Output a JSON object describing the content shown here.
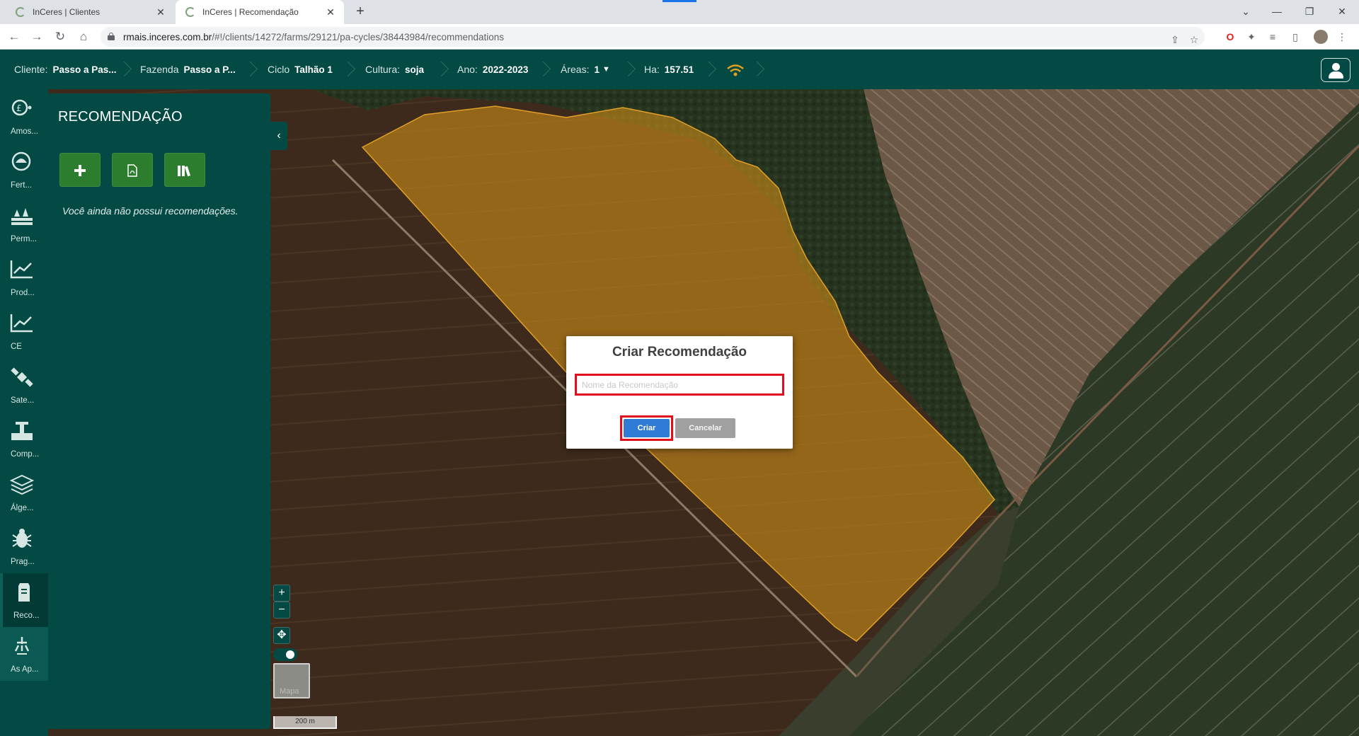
{
  "browser": {
    "tabs": [
      {
        "title": "InCeres | Clientes",
        "active": false
      },
      {
        "title": "InCeres | Recomendação",
        "active": true
      }
    ],
    "url_domain": "rmais.inceres.com.br",
    "url_path": "/#!/clients/14272/farms/29121/pa-cycles/38443984/recommendations"
  },
  "header": {
    "cliente_label": "Cliente:",
    "cliente_value": "Passo a Pas...",
    "fazenda_label": "Fazenda",
    "fazenda_value": "Passo a P...",
    "ciclo_label": "Ciclo",
    "ciclo_value": "Talhão 1",
    "cultura_label": "Cultura:",
    "cultura_value": "soja",
    "ano_label": "Ano:",
    "ano_value": "2022-2023",
    "areas_label": "Áreas:",
    "areas_value": "1",
    "ha_label": "Ha:",
    "ha_value": "157.51"
  },
  "rail": {
    "items": [
      {
        "label": "Amos...",
        "icon": "sampling-icon"
      },
      {
        "label": "Fert...",
        "icon": "fertility-icon"
      },
      {
        "label": "Perm...",
        "icon": "permanent-icon"
      },
      {
        "label": "Prod...",
        "icon": "productivity-chart-icon"
      },
      {
        "label": "CE",
        "icon": "ce-chart-icon"
      },
      {
        "label": "Sate...",
        "icon": "satellite-icon"
      },
      {
        "label": "Comp...",
        "icon": "compaction-icon"
      },
      {
        "label": "Álge...",
        "icon": "layers-icon"
      },
      {
        "label": "Prag...",
        "icon": "bug-icon"
      },
      {
        "label": "Reco...",
        "icon": "recommendation-icon"
      },
      {
        "label": "As Ap...",
        "icon": "sprayer-icon"
      }
    ]
  },
  "panel": {
    "title": "RECOMENDAÇÃO",
    "empty_text": "Você ainda não possui recomendações."
  },
  "map": {
    "scale_label": "200 m",
    "layer_label": "Mapa"
  },
  "modal": {
    "title": "Criar Recomendação",
    "input_placeholder": "Nome da Recomendação",
    "input_value": "",
    "create_label": "Criar",
    "cancel_label": "Cancelar"
  },
  "colors": {
    "brand": "#034a44",
    "field_highlight": "#c98a1a",
    "create_button": "#2f7bd5",
    "highlight_border": "#e00d1c"
  }
}
